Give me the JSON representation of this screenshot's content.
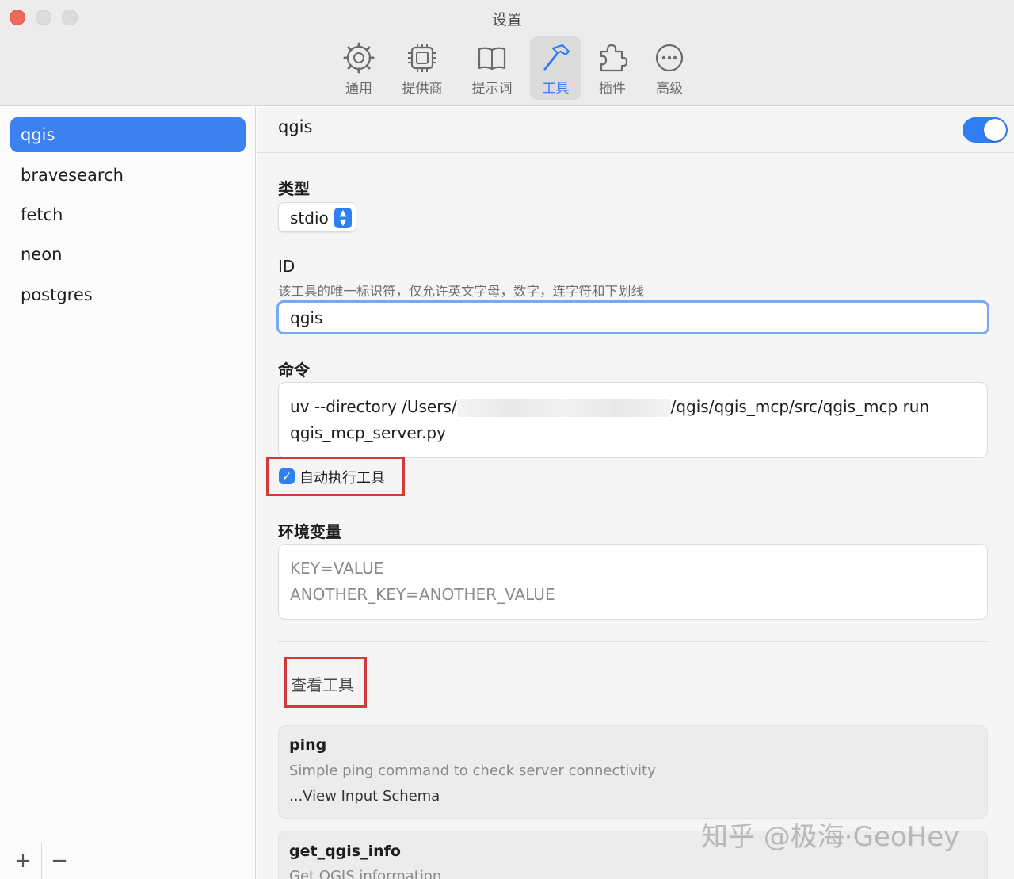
{
  "window": {
    "title": "设置"
  },
  "toolbar": {
    "tabs": [
      {
        "label": "通用",
        "icon": "gear-icon"
      },
      {
        "label": "提供商",
        "icon": "chip-icon"
      },
      {
        "label": "提示词",
        "icon": "book-icon"
      },
      {
        "label": "工具",
        "icon": "hammer-icon",
        "active": true
      },
      {
        "label": "插件",
        "icon": "puzzle-icon"
      },
      {
        "label": "高级",
        "icon": "ellipsis-icon"
      }
    ]
  },
  "sidebar": {
    "items": [
      {
        "label": "qgis",
        "selected": true
      },
      {
        "label": "bravesearch"
      },
      {
        "label": "fetch"
      },
      {
        "label": "neon"
      },
      {
        "label": "postgres"
      }
    ],
    "footer": {
      "add": "+",
      "remove": "−"
    }
  },
  "main": {
    "header": {
      "title": "qgis",
      "enabled": true
    },
    "type": {
      "label": "类型",
      "value": "stdio"
    },
    "id": {
      "label": "ID",
      "help": "该工具的唯一标识符，仅允许英文字母，数字，连字符和下划线",
      "value": "qgis"
    },
    "command": {
      "label": "命令",
      "line1_prefix": "uv --directory /Users/",
      "line1_suffix": "/qgis/qgis_mcp/src/qgis_mcp run",
      "line2": "qgis_mcp_server.py"
    },
    "auto_execute": {
      "label": "自动执行工具",
      "checked": true
    },
    "env": {
      "label": "环境变量",
      "placeholder_line1": "KEY=VALUE",
      "placeholder_line2": "ANOTHER_KEY=ANOTHER_VALUE"
    },
    "view_tools_label": "查看工具",
    "tools": [
      {
        "name": "ping",
        "description": "Simple ping command to check server connectivity",
        "schema_link": "...View Input Schema"
      },
      {
        "name": "get_qgis_info",
        "description": "Get QGIS information"
      }
    ]
  },
  "colors": {
    "accent": "#2f7ef2",
    "highlight_box": "#d23a3a"
  },
  "watermark": "知乎 @极海·GeoHey"
}
